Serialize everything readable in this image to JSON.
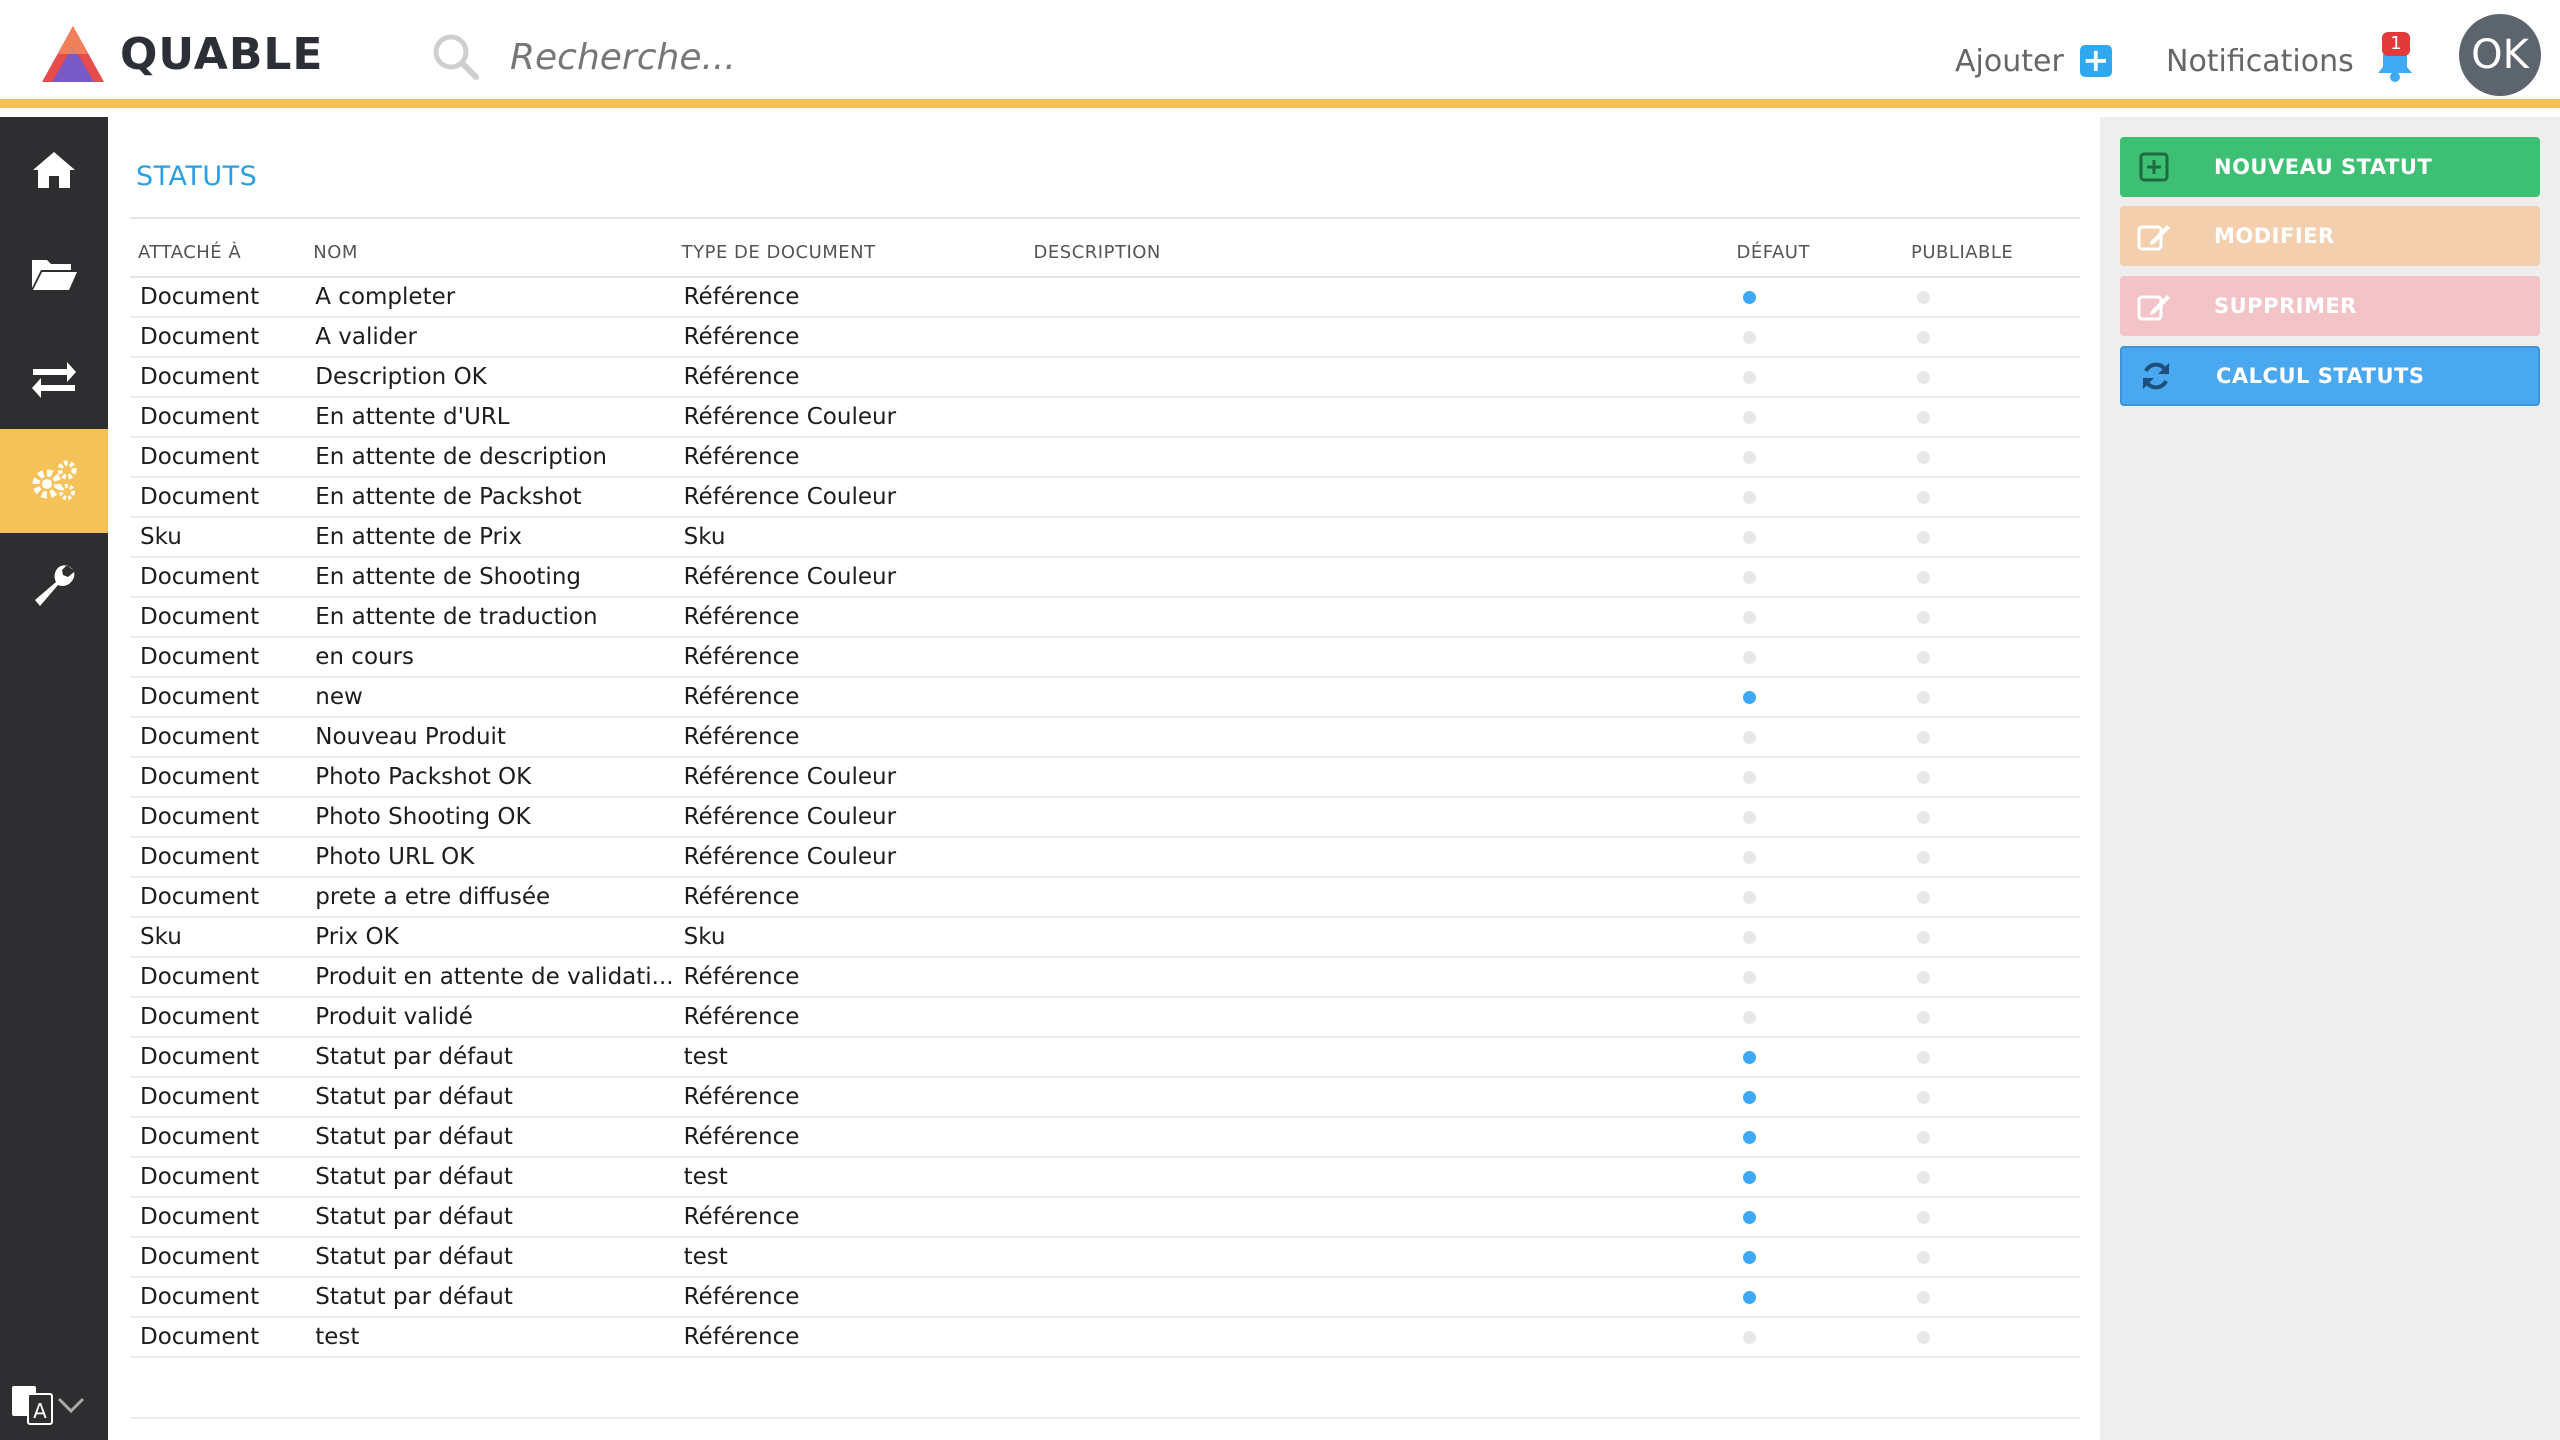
{
  "header": {
    "logo_text": "QUABLE",
    "search_placeholder": "Recherche...",
    "add_label": "Ajouter",
    "notifications_label": "Notifications",
    "notifications_count": "1",
    "avatar_initials": "OK"
  },
  "sidebar": {
    "items": [
      {
        "icon": "home-icon",
        "active": false
      },
      {
        "icon": "folder-open-icon",
        "active": false
      },
      {
        "icon": "transfer-arrows-icon",
        "active": false
      },
      {
        "icon": "gears-icon",
        "active": true
      },
      {
        "icon": "wrench-icon",
        "active": false
      }
    ],
    "language_icon": "translate-icon"
  },
  "page": {
    "title": "STATUTS"
  },
  "table": {
    "columns": [
      "ATTACHÉ À",
      "NOM",
      "TYPE DE DOCUMENT",
      "DESCRIPTION",
      "DÉFAUT",
      "PUBLIABLE"
    ],
    "rows": [
      {
        "attache": "Document",
        "nom": "A completer",
        "type": "Référence",
        "description": "",
        "defaut": true,
        "publiable": false
      },
      {
        "attache": "Document",
        "nom": "A valider",
        "type": "Référence",
        "description": "",
        "defaut": false,
        "publiable": false
      },
      {
        "attache": "Document",
        "nom": "Description OK",
        "type": "Référence",
        "description": "",
        "defaut": false,
        "publiable": false
      },
      {
        "attache": "Document",
        "nom": "En attente d'URL",
        "type": "Référence Couleur",
        "description": "",
        "defaut": false,
        "publiable": false
      },
      {
        "attache": "Document",
        "nom": "En attente de description",
        "type": "Référence",
        "description": "",
        "defaut": false,
        "publiable": false
      },
      {
        "attache": "Document",
        "nom": "En attente de Packshot",
        "type": "Référence Couleur",
        "description": "",
        "defaut": false,
        "publiable": false
      },
      {
        "attache": "Sku",
        "nom": "En attente de Prix",
        "type": "Sku",
        "description": "",
        "defaut": false,
        "publiable": false
      },
      {
        "attache": "Document",
        "nom": "En attente de Shooting",
        "type": "Référence Couleur",
        "description": "",
        "defaut": false,
        "publiable": false
      },
      {
        "attache": "Document",
        "nom": "En attente de traduction",
        "type": "Référence",
        "description": "",
        "defaut": false,
        "publiable": false
      },
      {
        "attache": "Document",
        "nom": "en cours",
        "type": "Référence",
        "description": "",
        "defaut": false,
        "publiable": false
      },
      {
        "attache": "Document",
        "nom": "new",
        "type": "Référence",
        "description": "",
        "defaut": true,
        "publiable": false
      },
      {
        "attache": "Document",
        "nom": "Nouveau Produit",
        "type": "Référence",
        "description": "",
        "defaut": false,
        "publiable": false
      },
      {
        "attache": "Document",
        "nom": "Photo Packshot OK",
        "type": "Référence Couleur",
        "description": "",
        "defaut": false,
        "publiable": false
      },
      {
        "attache": "Document",
        "nom": "Photo Shooting OK",
        "type": "Référence Couleur",
        "description": "",
        "defaut": false,
        "publiable": false
      },
      {
        "attache": "Document",
        "nom": "Photo URL OK",
        "type": "Référence Couleur",
        "description": "",
        "defaut": false,
        "publiable": false
      },
      {
        "attache": "Document",
        "nom": "prete a etre diffusée",
        "type": "Référence",
        "description": "",
        "defaut": false,
        "publiable": false
      },
      {
        "attache": "Sku",
        "nom": "Prix OK",
        "type": "Sku",
        "description": "",
        "defaut": false,
        "publiable": false
      },
      {
        "attache": "Document",
        "nom": "Produit en attente de validati...",
        "type": "Référence",
        "description": "",
        "defaut": false,
        "publiable": false
      },
      {
        "attache": "Document",
        "nom": "Produit validé",
        "type": "Référence",
        "description": "",
        "defaut": false,
        "publiable": false
      },
      {
        "attache": "Document",
        "nom": "Statut par défaut",
        "type": "test",
        "description": "",
        "defaut": true,
        "publiable": false
      },
      {
        "attache": "Document",
        "nom": "Statut par défaut",
        "type": "Référence",
        "description": "",
        "defaut": true,
        "publiable": false
      },
      {
        "attache": "Document",
        "nom": "Statut par défaut",
        "type": "Référence",
        "description": "",
        "defaut": true,
        "publiable": false
      },
      {
        "attache": "Document",
        "nom": "Statut par défaut",
        "type": "test",
        "description": "",
        "defaut": true,
        "publiable": false
      },
      {
        "attache": "Document",
        "nom": "Statut par défaut",
        "type": "Référence",
        "description": "",
        "defaut": true,
        "publiable": false
      },
      {
        "attache": "Document",
        "nom": "Statut par défaut",
        "type": "test",
        "description": "",
        "defaut": true,
        "publiable": false
      },
      {
        "attache": "Document",
        "nom": "Statut par défaut",
        "type": "Référence",
        "description": "",
        "defaut": true,
        "publiable": false
      },
      {
        "attache": "Document",
        "nom": "test",
        "type": "Référence",
        "description": "",
        "defaut": false,
        "publiable": false
      }
    ]
  },
  "actions": {
    "new_label": "NOUVEAU STATUT",
    "edit_label": "MODIFIER",
    "delete_label": "SUPPRIMER",
    "calc_label": "CALCUL STATUTS"
  },
  "colors": {
    "accent_yellow": "#f5c25a",
    "title_blue": "#2a9fe6",
    "dot_on": "#3fa9f5",
    "dot_off": "#e8e8e8",
    "btn_new": "#3dbf74",
    "btn_edit_disabled": "#f3cfae",
    "btn_delete_disabled": "#f2c3c7",
    "btn_calc": "#4aa8f0",
    "sidebar_bg": "#2e2e30"
  }
}
